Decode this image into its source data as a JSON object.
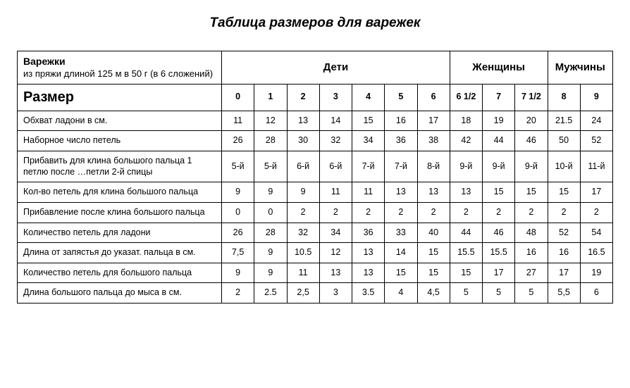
{
  "title": "Таблица размеров для варежек",
  "header": {
    "main": "Варежки",
    "sub": "из пряжи длиной 125 м в 50 г (в 6 сложений)",
    "groups": {
      "children": "Дети",
      "women": "Женщины",
      "men": "Мужчины"
    }
  },
  "size_row": {
    "label": "Размер",
    "values": [
      "0",
      "1",
      "2",
      "3",
      "4",
      "5",
      "6",
      "6 1/2",
      "7",
      "7 1/2",
      "8",
      "9"
    ]
  },
  "rows": [
    {
      "label": "Обхват ладони в см.",
      "values": [
        "11",
        "12",
        "13",
        "14",
        "15",
        "16",
        "17",
        "18",
        "19",
        "20",
        "21.5",
        "24"
      ]
    },
    {
      "label": "Наборное число петель",
      "values": [
        "26",
        "28",
        "30",
        "32",
        "34",
        "36",
        "38",
        "42",
        "44",
        "46",
        "50",
        "52"
      ]
    },
    {
      "label": "Прибавить для клина большого пальца 1 петлю после …петли 2-й спицы",
      "values": [
        "5-й",
        "5-й",
        "6-й",
        "6-й",
        "7-й",
        "7-й",
        "8-й",
        "9-й",
        "9-й",
        "9-й",
        "10-й",
        "11-й"
      ]
    },
    {
      "label": "Кол-во петель для клина большого пальца",
      "values": [
        "9",
        "9",
        "9",
        "11",
        "11",
        "13",
        "13",
        "13",
        "15",
        "15",
        "15",
        "17"
      ]
    },
    {
      "label": "Прибавление после клина большого пальца",
      "values": [
        "0",
        "0",
        "2",
        "2",
        "2",
        "2",
        "2",
        "2",
        "2",
        "2",
        "2",
        "2"
      ]
    },
    {
      "label": "Количество петель для ладони",
      "values": [
        "26",
        "28",
        "32",
        "34",
        "36",
        "33",
        "40",
        "44",
        "46",
        "48",
        "52",
        "54"
      ]
    },
    {
      "label": "Длина от запястья до указат. пальца в см.",
      "values": [
        "7,5",
        "9",
        "10.5",
        "12",
        "13",
        "14",
        "15",
        "15.5",
        "15.5",
        "16",
        "16",
        "16.5"
      ]
    },
    {
      "label": "Количество петель для большого пальца",
      "values": [
        "9",
        "9",
        "11",
        "13",
        "13",
        "15",
        "15",
        "15",
        "17",
        "27",
        "17",
        "19"
      ]
    },
    {
      "label": "Длина большого пальца до мыса в см.",
      "values": [
        "2",
        "2.5",
        "2,5",
        "3",
        "3.5",
        "4",
        "4,5",
        "5",
        "5",
        "5",
        "5,5",
        "6"
      ]
    }
  ],
  "chart_data": {
    "type": "table",
    "title": "Таблица размеров для варежек",
    "column_groups": [
      {
        "name": "Дети",
        "sizes": [
          "0",
          "1",
          "2",
          "3",
          "4",
          "5",
          "6"
        ]
      },
      {
        "name": "Женщины",
        "sizes": [
          "6 1/2",
          "7",
          "7 1/2"
        ]
      },
      {
        "name": "Мужчины",
        "sizes": [
          "8",
          "9"
        ]
      }
    ],
    "columns": [
      "0",
      "1",
      "2",
      "3",
      "4",
      "5",
      "6",
      "6 1/2",
      "7",
      "7 1/2",
      "8",
      "9"
    ],
    "rows": [
      {
        "metric": "Обхват ладони в см.",
        "values": [
          11,
          12,
          13,
          14,
          15,
          16,
          17,
          18,
          19,
          20,
          21.5,
          24
        ]
      },
      {
        "metric": "Наборное число петель",
        "values": [
          26,
          28,
          30,
          32,
          34,
          36,
          38,
          42,
          44,
          46,
          50,
          52
        ]
      },
      {
        "metric": "Прибавить для клина большого пальца 1 петлю после …петли 2-й спицы",
        "values": [
          "5-й",
          "5-й",
          "6-й",
          "6-й",
          "7-й",
          "7-й",
          "8-й",
          "9-й",
          "9-й",
          "9-й",
          "10-й",
          "11-й"
        ]
      },
      {
        "metric": "Кол-во петель для клина большого пальца",
        "values": [
          9,
          9,
          9,
          11,
          11,
          13,
          13,
          13,
          15,
          15,
          15,
          17
        ]
      },
      {
        "metric": "Прибавление после клина большого пальца",
        "values": [
          0,
          0,
          2,
          2,
          2,
          2,
          2,
          2,
          2,
          2,
          2,
          2
        ]
      },
      {
        "metric": "Количество петель для ладони",
        "values": [
          26,
          28,
          32,
          34,
          36,
          33,
          40,
          44,
          46,
          48,
          52,
          54
        ]
      },
      {
        "metric": "Длина от запястья до указат. пальца в см.",
        "values": [
          7.5,
          9,
          10.5,
          12,
          13,
          14,
          15,
          15.5,
          15.5,
          16,
          16,
          16.5
        ]
      },
      {
        "metric": "Количество петель для большого пальца",
        "values": [
          9,
          9,
          11,
          13,
          13,
          15,
          15,
          15,
          17,
          27,
          17,
          19
        ]
      },
      {
        "metric": "Длина большого пальца до мыса в см.",
        "values": [
          2,
          2.5,
          2.5,
          3,
          3.5,
          4,
          4.5,
          5,
          5,
          5,
          5.5,
          6
        ]
      }
    ]
  }
}
